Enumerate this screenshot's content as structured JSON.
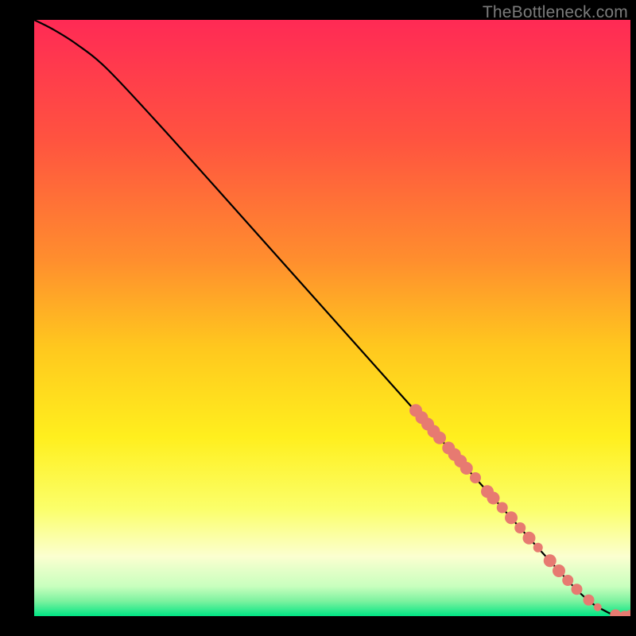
{
  "watermark": "TheBottleneck.com",
  "chart_data": {
    "type": "line",
    "title": "",
    "xlabel": "",
    "ylabel": "",
    "xlim": [
      0,
      100
    ],
    "ylim": [
      0,
      100
    ],
    "background_gradient": {
      "stops": [
        {
          "offset": 0.0,
          "color": "#ff2a55"
        },
        {
          "offset": 0.2,
          "color": "#ff5340"
        },
        {
          "offset": 0.4,
          "color": "#ff8d2e"
        },
        {
          "offset": 0.55,
          "color": "#ffc81e"
        },
        {
          "offset": 0.7,
          "color": "#ffef1e"
        },
        {
          "offset": 0.82,
          "color": "#fbff6a"
        },
        {
          "offset": 0.9,
          "color": "#fbffd0"
        },
        {
          "offset": 0.95,
          "color": "#c8ffbe"
        },
        {
          "offset": 0.975,
          "color": "#7cf29f"
        },
        {
          "offset": 1.0,
          "color": "#00e584"
        }
      ]
    },
    "series": [
      {
        "name": "bottleneck-curve",
        "color": "#000000",
        "x": [
          0,
          3,
          7,
          12,
          20,
          30,
          40,
          50,
          60,
          70,
          78,
          84,
          88,
          91,
          93.5,
          95.5,
          97,
          99,
          100
        ],
        "y": [
          100,
          98.5,
          96,
          92,
          83.5,
          72.4,
          61.2,
          50.0,
          38.8,
          27.6,
          18.7,
          12.0,
          7.6,
          4.4,
          2.2,
          1.0,
          0.3,
          0.05,
          0.05
        ]
      }
    ],
    "markers": {
      "name": "highlight-points",
      "color": "#e77a71",
      "radius": 7.5,
      "points": [
        {
          "x": 64.0,
          "y": 34.5,
          "r": 8
        },
        {
          "x": 65.0,
          "y": 33.3,
          "r": 8
        },
        {
          "x": 66.0,
          "y": 32.2,
          "r": 8
        },
        {
          "x": 67.0,
          "y": 31.0,
          "r": 8
        },
        {
          "x": 68.0,
          "y": 29.9,
          "r": 8
        },
        {
          "x": 69.5,
          "y": 28.2,
          "r": 8
        },
        {
          "x": 70.5,
          "y": 27.1,
          "r": 8
        },
        {
          "x": 71.5,
          "y": 26.0,
          "r": 8
        },
        {
          "x": 72.5,
          "y": 24.8,
          "r": 8
        },
        {
          "x": 74.0,
          "y": 23.2,
          "r": 7
        },
        {
          "x": 76.0,
          "y": 20.9,
          "r": 8
        },
        {
          "x": 77.0,
          "y": 19.8,
          "r": 8
        },
        {
          "x": 78.5,
          "y": 18.2,
          "r": 7
        },
        {
          "x": 80.0,
          "y": 16.5,
          "r": 8
        },
        {
          "x": 81.5,
          "y": 14.8,
          "r": 7
        },
        {
          "x": 83.0,
          "y": 13.1,
          "r": 8
        },
        {
          "x": 84.5,
          "y": 11.5,
          "r": 6
        },
        {
          "x": 86.5,
          "y": 9.3,
          "r": 8
        },
        {
          "x": 88.0,
          "y": 7.6,
          "r": 8
        },
        {
          "x": 89.5,
          "y": 6.0,
          "r": 7
        },
        {
          "x": 91.0,
          "y": 4.5,
          "r": 7
        },
        {
          "x": 93.0,
          "y": 2.7,
          "r": 7
        },
        {
          "x": 94.5,
          "y": 1.5,
          "r": 5
        },
        {
          "x": 97.5,
          "y": 0.2,
          "r": 7
        },
        {
          "x": 99.0,
          "y": 0.1,
          "r": 6
        },
        {
          "x": 100.0,
          "y": 0.1,
          "r": 7
        }
      ]
    }
  }
}
